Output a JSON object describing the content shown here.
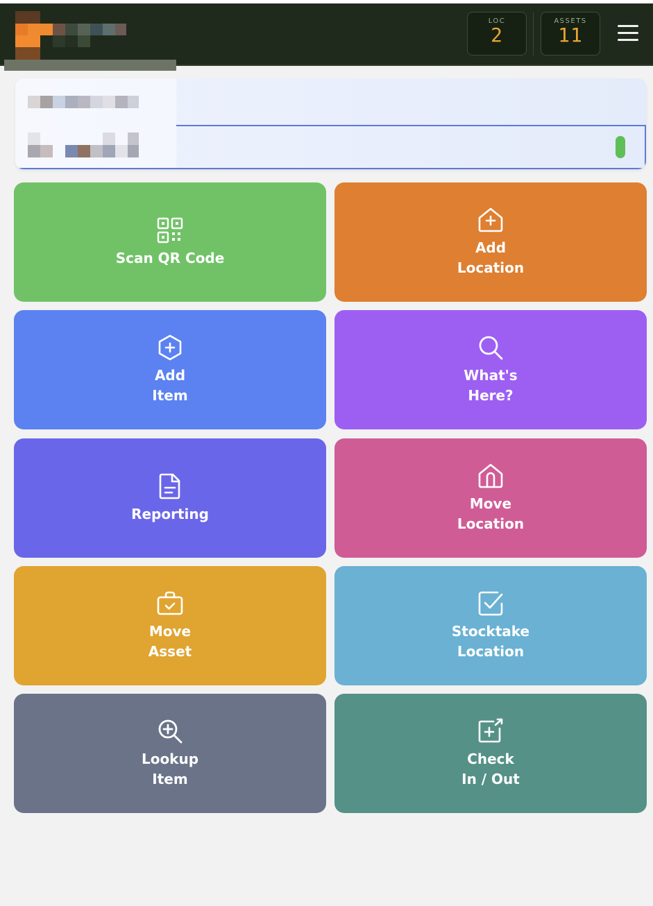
{
  "header": {
    "stats": {
      "loc_label": "LOC",
      "loc_value": "2",
      "assets_label": "ASSETS",
      "assets_value": "11"
    },
    "menu_icon": "hamburger-menu-icon"
  },
  "colors": {
    "header_bg": "#1f2a1c",
    "stat_value": "#e8a631",
    "page_bg": "#f2f2f2",
    "field_border": "#5b7bd6",
    "status_green": "#5fbf57"
  },
  "tiles": [
    {
      "lines": [
        "Scan QR Code"
      ],
      "icon": "qr-code-icon",
      "color": "#71c267"
    },
    {
      "lines": [
        "Add",
        "Location"
      ],
      "icon": "house-plus-icon",
      "color": "#de7f31"
    },
    {
      "lines": [
        "Add",
        "Item"
      ],
      "icon": "hexagon-plus-icon",
      "color": "#5b82f0"
    },
    {
      "lines": [
        "What's",
        "Here?"
      ],
      "icon": "search-icon",
      "color": "#9d5ff2"
    },
    {
      "lines": [
        "Reporting"
      ],
      "icon": "document-icon",
      "color": "#6a66e9"
    },
    {
      "lines": [
        "Move",
        "Location"
      ],
      "icon": "house-door-icon",
      "color": "#d05c96"
    },
    {
      "lines": [
        "Move",
        "Asset"
      ],
      "icon": "briefcase-check-icon",
      "color": "#e0a431"
    },
    {
      "lines": [
        "Stocktake",
        "Location"
      ],
      "icon": "checkbox-icon",
      "color": "#6ab1d3"
    },
    {
      "lines": [
        "Lookup",
        "Item"
      ],
      "icon": "zoom-plus-icon",
      "color": "#6b7389"
    },
    {
      "lines": [
        "Check",
        "In / Out"
      ],
      "icon": "box-arrow-plus-icon",
      "color": "#559187"
    }
  ]
}
